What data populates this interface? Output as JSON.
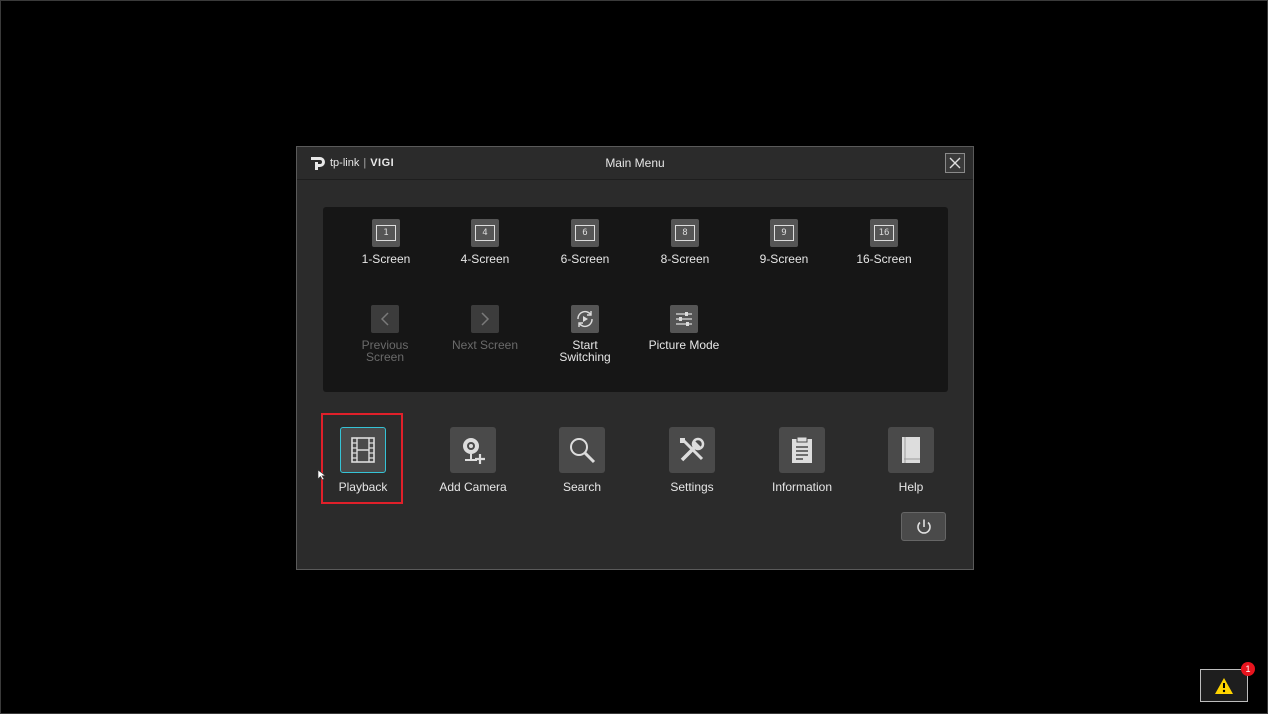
{
  "dialog": {
    "brand": {
      "tplink": "tp-link",
      "separator": "|",
      "vigi": "VIGI"
    },
    "title": "Main Menu"
  },
  "screen_layouts": [
    {
      "label": "1-Screen",
      "glyph": "1"
    },
    {
      "label": "4-Screen",
      "glyph": "4"
    },
    {
      "label": "6-Screen",
      "glyph": "6"
    },
    {
      "label": "8-Screen",
      "glyph": "8"
    },
    {
      "label": "9-Screen",
      "glyph": "9"
    },
    {
      "label": "16-Screen",
      "glyph": "16"
    }
  ],
  "screen_controls": [
    {
      "label_line1": "Previous",
      "label_line2": "Screen",
      "enabled": false
    },
    {
      "label_line1": "Next Screen",
      "label_line2": "",
      "enabled": false
    },
    {
      "label_line1": "Start",
      "label_line2": "Switching",
      "enabled": true
    },
    {
      "label_line1": "Picture Mode",
      "label_line2": "",
      "enabled": true
    }
  ],
  "main_items": [
    {
      "label": "Playback",
      "icon": "film-icon",
      "selected": true
    },
    {
      "label": "Add Camera",
      "icon": "camera-add-icon"
    },
    {
      "label": "Search",
      "icon": "search-icon"
    },
    {
      "label": "Settings",
      "icon": "tools-icon"
    },
    {
      "label": "Information",
      "icon": "clipboard-icon"
    },
    {
      "label": "Help",
      "icon": "book-icon"
    }
  ],
  "alarm": {
    "count": "1"
  },
  "colors": {
    "accent": "#35c3d6",
    "highlight": "#e0202a",
    "badge": "#e8141e",
    "warning": "#ffd400"
  }
}
